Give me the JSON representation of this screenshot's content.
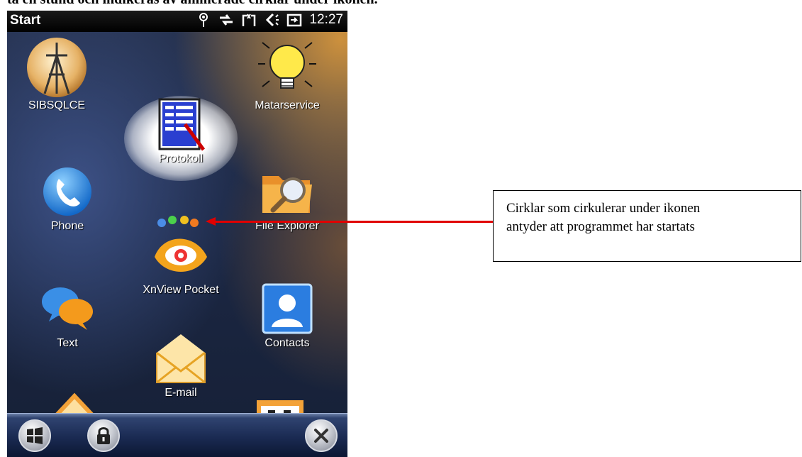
{
  "document": {
    "top_line": "ta en stund och indikeras av animerade cirklar under ikonen."
  },
  "statusbar": {
    "title": "Start",
    "time": "12:27",
    "icons": [
      "signal-antenna-icon",
      "data-transfer-icon",
      "missed-call-icon",
      "volume-icon",
      "battery-charging-icon"
    ]
  },
  "apps": [
    {
      "label": "SIBSQLCE",
      "icon": "sibsqlce-icon"
    },
    {
      "label": "Protokoll",
      "icon": "protokoll-icon"
    },
    {
      "label": "Matarservice",
      "icon": "lightbulb-icon"
    },
    {
      "label": "Phone",
      "icon": "phone-icon"
    },
    {
      "label": "XnView Pocket",
      "icon": "xnview-icon"
    },
    {
      "label": "File Explorer",
      "icon": "folder-magnifier-icon"
    },
    {
      "label": "Text",
      "icon": "speech-bubbles-icon"
    },
    {
      "label": "E-mail",
      "icon": "envelope-icon"
    },
    {
      "label": "Contacts",
      "icon": "contact-card-icon"
    }
  ],
  "bottombar": {
    "buttons": [
      "windows-start-icon",
      "lock-icon",
      "close-icon"
    ]
  },
  "annotation": {
    "text_line1": "Cirklar som cirkulerar under ikonen",
    "text_line2": "antyder att programmet har startats",
    "arrow_color": "#e00000"
  }
}
